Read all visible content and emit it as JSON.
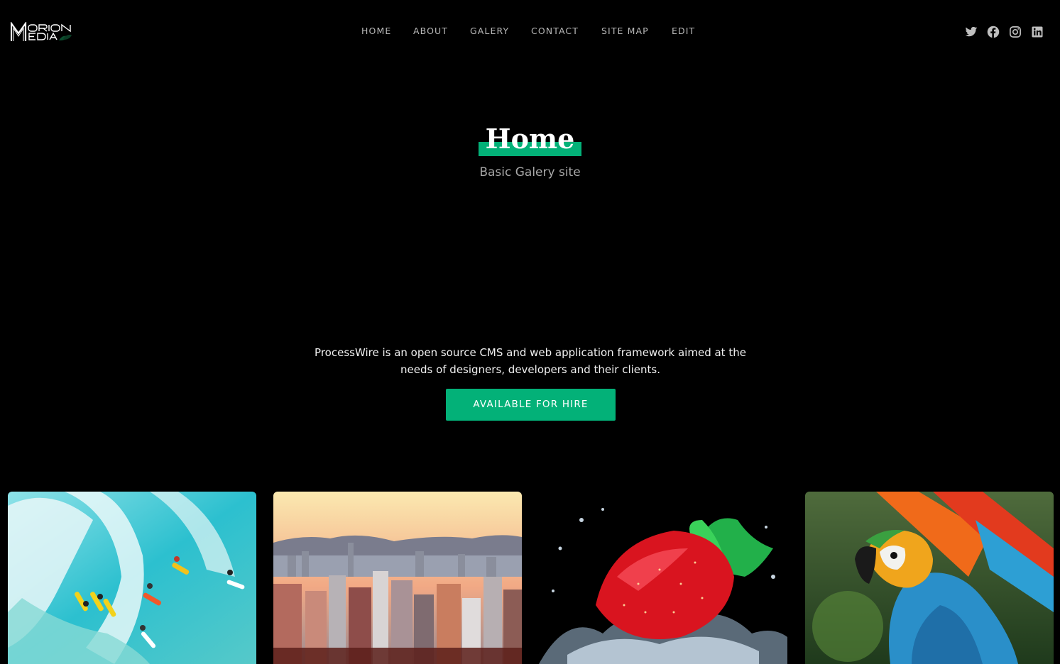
{
  "header": {
    "logo_alt": "Marion Media",
    "nav": [
      {
        "label": "HOME"
      },
      {
        "label": "ABOUT"
      },
      {
        "label": "GALERY"
      },
      {
        "label": "CONTACT"
      },
      {
        "label": "SITE MAP"
      },
      {
        "label": "EDIT"
      }
    ],
    "social": [
      {
        "icon": "twitter-icon"
      },
      {
        "icon": "facebook-icon"
      },
      {
        "icon": "instagram-icon"
      },
      {
        "icon": "linkedin-icon"
      }
    ]
  },
  "hero": {
    "title": "Home",
    "subtitle": "Basic Galery site"
  },
  "intro": {
    "text": "ProcessWire is an open source CMS and web application framework aimed at the needs of designers, developers and their clients.",
    "cta_label": "AVAILABLE FOR HIRE"
  },
  "gallery": [
    {
      "subject": "surfers-wave"
    },
    {
      "subject": "city-skyline"
    },
    {
      "subject": "strawberry-splash"
    },
    {
      "subject": "macaw-parrot"
    }
  ],
  "colors": {
    "background": "#000000",
    "accent": "#03b178",
    "nav_text": "#b8b8b8",
    "subtitle_text": "#a8a8a8"
  }
}
